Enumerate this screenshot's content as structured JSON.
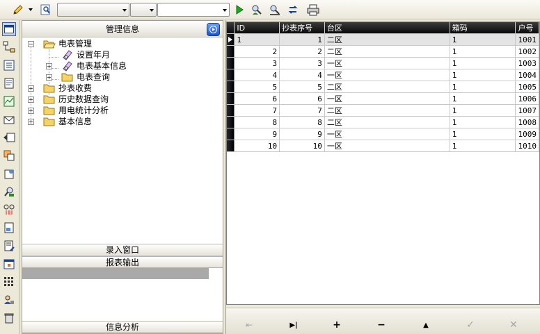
{
  "nav": {
    "header": "管理信息",
    "tree": [
      {
        "label": "电表管理",
        "expanded": true,
        "children": [
          {
            "label": "设置年月",
            "type": "leaf"
          },
          {
            "label": "电表基本信息",
            "type": "expandable"
          },
          {
            "label": "电表查询",
            "type": "expandable"
          }
        ]
      },
      {
        "label": "抄表收费"
      },
      {
        "label": "历史数据查询"
      },
      {
        "label": "用电统计分析"
      },
      {
        "label": "基本信息"
      }
    ],
    "bars": {
      "entry": "录入窗口",
      "report": "报表输出",
      "analysis": "信息分析"
    }
  },
  "grid": {
    "columns": [
      "ID",
      "抄表序号",
      "台区",
      "箱码",
      "户号"
    ],
    "rows": [
      [
        "1",
        "1",
        "二区",
        "1",
        "1001"
      ],
      [
        "2",
        "2",
        "二区",
        "1",
        "1002"
      ],
      [
        "3",
        "3",
        "一区",
        "1",
        "1003"
      ],
      [
        "4",
        "4",
        "一区",
        "1",
        "1004"
      ],
      [
        "5",
        "5",
        "二区",
        "1",
        "1005"
      ],
      [
        "6",
        "6",
        "一区",
        "1",
        "1006"
      ],
      [
        "7",
        "7",
        "二区",
        "1",
        "1007"
      ],
      [
        "8",
        "8",
        "二区",
        "1",
        "1008"
      ],
      [
        "9",
        "9",
        "一区",
        "1",
        "1009"
      ],
      [
        "10",
        "10",
        "一区",
        "1",
        "1010"
      ]
    ]
  },
  "navigator": {
    "first": "⇤",
    "last": "▶|",
    "add": "+",
    "delete": "−",
    "up": "▲",
    "edit": "✓",
    "cancel": "✕"
  },
  "colors": {
    "header_bg": "#1a1a1a",
    "selected_row": "#e4e4e4",
    "nav_go": "#2a62d8"
  }
}
